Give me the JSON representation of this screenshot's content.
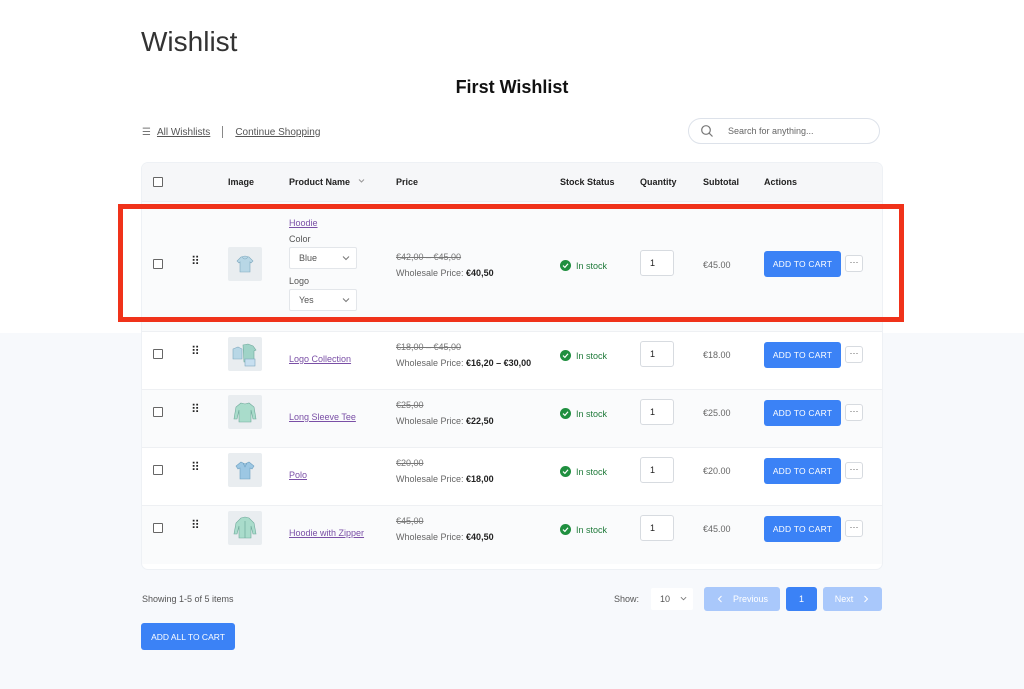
{
  "page": {
    "title": "Wishlist",
    "wishlist_name": "First Wishlist"
  },
  "toolbar": {
    "all_wishlists": "All Wishlists",
    "continue_shopping": "Continue Shopping"
  },
  "search": {
    "placeholder": "Search for anything..."
  },
  "table": {
    "headers": {
      "image": "Image",
      "product_name": "Product Name",
      "price": "Price",
      "stock_status": "Stock Status",
      "quantity": "Quantity",
      "subtotal": "Subtotal",
      "actions": "Actions"
    },
    "rows": [
      {
        "name": "Hoodie",
        "color_label": "Color",
        "color_value": "Blue",
        "logo_label": "Logo",
        "logo_value": "Yes",
        "price_old": "€42,00 – €45,00",
        "wholesale_label": "Wholesale Price:",
        "wholesale_value": "€40,50",
        "stock": "In stock",
        "qty": "1",
        "subtotal": "€45.00",
        "cart_label": "ADD TO CART",
        "more_label": "···"
      },
      {
        "name": "Logo Collection",
        "price_old": "€18,00 – €45,00",
        "wholesale_label": "Wholesale Price:",
        "wholesale_value": "€16,20 – €30,00",
        "stock": "In stock",
        "qty": "1",
        "subtotal": "€18.00",
        "cart_label": "ADD TO CART",
        "more_label": "···"
      },
      {
        "name": "Long Sleeve Tee",
        "price_old": "€25,00",
        "wholesale_label": "Wholesale Price:",
        "wholesale_value": "€22,50",
        "stock": "In stock",
        "qty": "1",
        "subtotal": "€25.00",
        "cart_label": "ADD TO CART",
        "more_label": "···"
      },
      {
        "name": "Polo",
        "price_old": "€20,00",
        "wholesale_label": "Wholesale Price:",
        "wholesale_value": "€18,00",
        "stock": "In stock",
        "qty": "1",
        "subtotal": "€20.00",
        "cart_label": "ADD TO CART",
        "more_label": "···"
      },
      {
        "name": "Hoodie with Zipper",
        "price_old": "€45,00",
        "wholesale_label": "Wholesale Price:",
        "wholesale_value": "€40,50",
        "stock": "In stock",
        "qty": "1",
        "subtotal": "€45.00",
        "cart_label": "ADD TO CART",
        "more_label": "···"
      }
    ]
  },
  "footer": {
    "showing": "Showing 1-5 of 5 items",
    "show_label": "Show:",
    "per_page": "10",
    "prev_label": "Previous",
    "page_number": "1",
    "next_label": "Next",
    "add_all_label": "ADD ALL TO CART"
  },
  "colors": {
    "accent": "#3b82f6",
    "highlight": "#f0321a",
    "stock_green": "#1f8f3f",
    "link_purple": "#7a4fa6"
  },
  "icons": [
    "menu-icon",
    "search-icon",
    "sort-icon",
    "drag-handle-icon",
    "check-circle-icon",
    "chevron-down-icon",
    "chevron-left-icon",
    "chevron-right-icon"
  ]
}
